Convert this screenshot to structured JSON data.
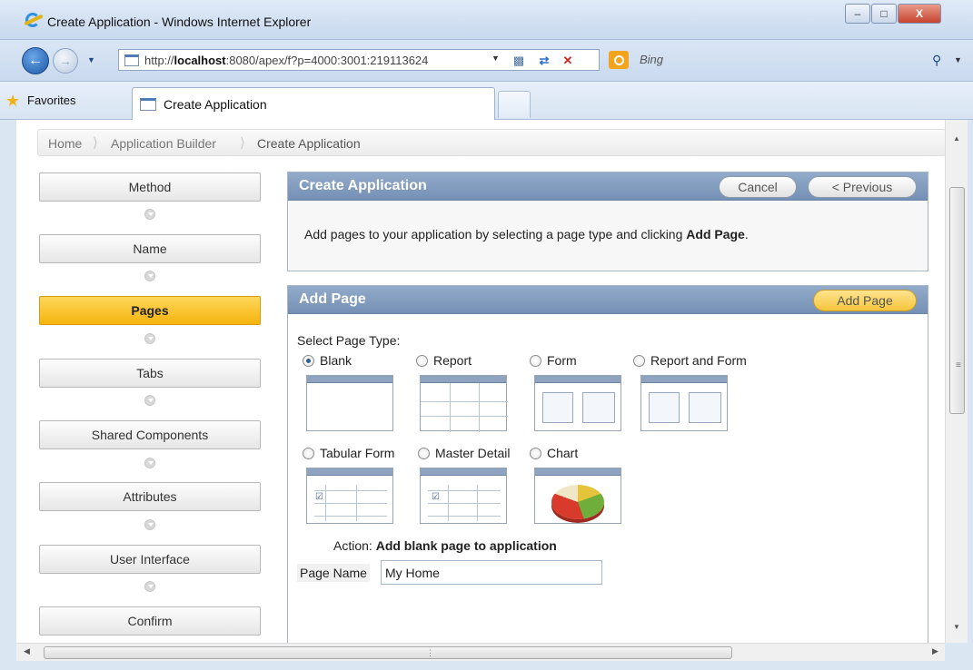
{
  "window": {
    "title": "Create Application - Windows Internet Explorer",
    "minimize": "–",
    "maximize": "□",
    "close": "X"
  },
  "nav": {
    "url_plain": "http://",
    "url_host": "localhost",
    "url_rest": ":8080/apex/f?p=4000:3001:219113624",
    "search_placeholder": "Bing"
  },
  "favorites": {
    "label": "Favorites",
    "tab_title": "Create Application"
  },
  "breadcrumb": [
    "Home",
    "Application Builder",
    "Create Application"
  ],
  "wizard": {
    "steps": [
      {
        "label": "Method",
        "active": false
      },
      {
        "label": "Name",
        "active": false
      },
      {
        "label": "Pages",
        "active": true
      },
      {
        "label": "Tabs",
        "active": false
      },
      {
        "label": "Shared Components",
        "active": false
      },
      {
        "label": "Attributes",
        "active": false
      },
      {
        "label": "User Interface",
        "active": false
      },
      {
        "label": "Confirm",
        "active": false
      }
    ]
  },
  "create_region": {
    "title": "Create Application",
    "cancel": "Cancel",
    "previous": "< Previous",
    "text_prefix": "Add pages to your application by selecting a page type and clicking ",
    "text_bold": "Add Page",
    "text_suffix": "."
  },
  "add_page": {
    "title": "Add Page",
    "button": "Add Page",
    "select_label": "Select Page Type:",
    "types": [
      {
        "label": "Blank",
        "selected": true
      },
      {
        "label": "Report",
        "selected": false
      },
      {
        "label": "Form",
        "selected": false
      },
      {
        "label": "Report and Form",
        "selected": false
      },
      {
        "label": "Tabular Form",
        "selected": false
      },
      {
        "label": "Master Detail",
        "selected": false
      },
      {
        "label": "Chart",
        "selected": false
      }
    ],
    "action_label": "Action:",
    "action_value": "Add blank page to application",
    "page_name_label": "Page Name",
    "page_name_value": "My Home"
  },
  "icons": {
    "back": "left-arrow",
    "forward": "right-arrow",
    "refresh": "refresh-arrows",
    "stop": "x-mark",
    "search": "magnifier",
    "favorites": "star"
  },
  "colors": {
    "active_step": "#f6b40e",
    "panel_header": "#7f99bd",
    "add_page_button": "#f6c53c"
  }
}
